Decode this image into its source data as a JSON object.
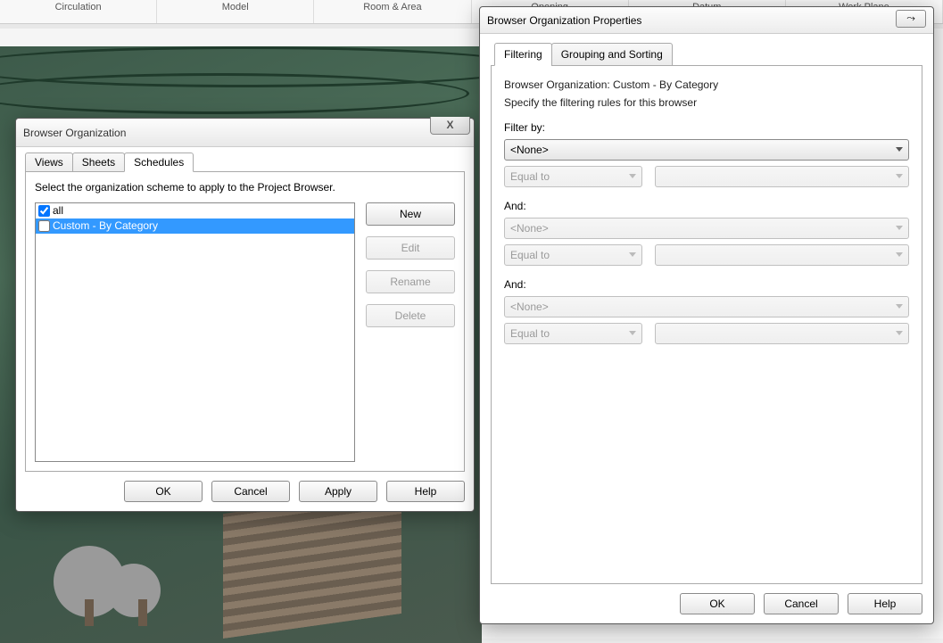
{
  "ribbon": {
    "groups": [
      "Circulation",
      "Model",
      "Room & Area",
      "Opening",
      "Datum",
      "Work Plane"
    ]
  },
  "dialog1": {
    "title": "Browser Organization",
    "close_glyph": "X",
    "tabs": {
      "views": "Views",
      "sheets": "Sheets",
      "schedules": "Schedules"
    },
    "active_tab": "schedules",
    "instruction": "Select the organization scheme to apply to the Project Browser.",
    "schemes": [
      {
        "label": "all",
        "checked": true,
        "selected": false
      },
      {
        "label": "Custom - By Category",
        "checked": false,
        "selected": true
      }
    ],
    "buttons": {
      "new": "New",
      "edit": "Edit",
      "rename": "Rename",
      "delete": "Delete"
    },
    "footer": {
      "ok": "OK",
      "cancel": "Cancel",
      "apply": "Apply",
      "help": "Help"
    }
  },
  "dialog2": {
    "title": "Browser Organization Properties",
    "close_glyph": "⤳",
    "tabs": {
      "filtering": "Filtering",
      "grouping": "Grouping and Sorting"
    },
    "active_tab": "filtering",
    "heading": "Browser Organization: Custom - By Category",
    "subheading": "Specify the filtering rules for this browser",
    "labels": {
      "filter_by": "Filter by:",
      "and": "And:"
    },
    "none_option": "<None>",
    "equal_to": "Equal to",
    "footer": {
      "ok": "OK",
      "cancel": "Cancel",
      "help": "Help"
    }
  }
}
